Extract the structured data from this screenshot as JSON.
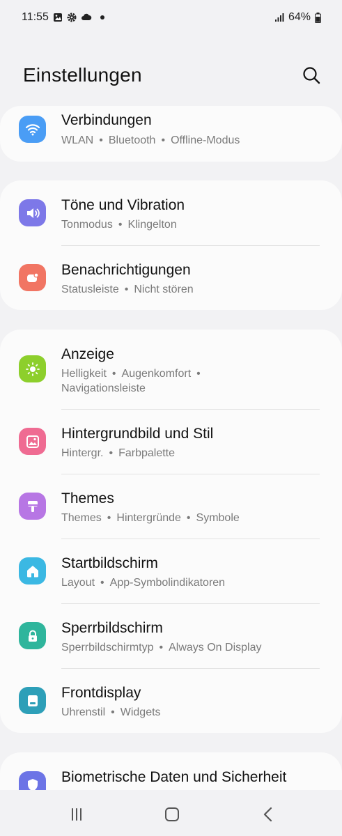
{
  "status": {
    "time": "11:55",
    "battery": "64%"
  },
  "header": {
    "title": "Einstellungen"
  },
  "groups": [
    {
      "items": [
        {
          "title": "Verbindungen",
          "subtitle": [
            "WLAN",
            "Bluetooth",
            "Offline-Modus"
          ],
          "icon": "wifi-icon",
          "color": "#4a9df5"
        }
      ]
    },
    {
      "items": [
        {
          "title": "Töne und Vibration",
          "subtitle": [
            "Tonmodus",
            "Klingelton"
          ],
          "icon": "volume-icon",
          "color": "#7d78e8"
        },
        {
          "title": "Benachrichtigungen",
          "subtitle": [
            "Statusleiste",
            "Nicht stören"
          ],
          "icon": "notification-icon",
          "color": "#f17563"
        }
      ]
    },
    {
      "items": [
        {
          "title": "Anzeige",
          "subtitle": [
            "Helligkeit",
            "Augenkomfort",
            "Navigationsleiste"
          ],
          "icon": "brightness-icon",
          "color": "#8dcf2c"
        },
        {
          "title": "Hintergrundbild und Stil",
          "subtitle": [
            "Hintergr.",
            "Farbpalette"
          ],
          "icon": "wallpaper-icon",
          "color": "#ef6b92"
        },
        {
          "title": "Themes",
          "subtitle": [
            "Themes",
            "Hintergründe",
            "Symbole"
          ],
          "icon": "paintbrush-icon",
          "color": "#b776e4"
        },
        {
          "title": "Startbildschirm",
          "subtitle": [
            "Layout",
            "App-Symbolindikatoren"
          ],
          "icon": "home-icon",
          "color": "#3bb8e3"
        },
        {
          "title": "Sperrbildschirm",
          "subtitle": [
            "Sperrbildschirmtyp",
            "Always On Display"
          ],
          "icon": "lock-icon",
          "color": "#2fb59c"
        },
        {
          "title": "Frontdisplay",
          "subtitle": [
            "Uhrenstil",
            "Widgets"
          ],
          "icon": "front-display-icon",
          "color": "#2d9fb8"
        }
      ]
    },
    {
      "items": [
        {
          "title": "Biometrische Daten und Sicherheit",
          "subtitle": [],
          "icon": "shield-icon",
          "color": "#6c74e6"
        }
      ]
    }
  ]
}
